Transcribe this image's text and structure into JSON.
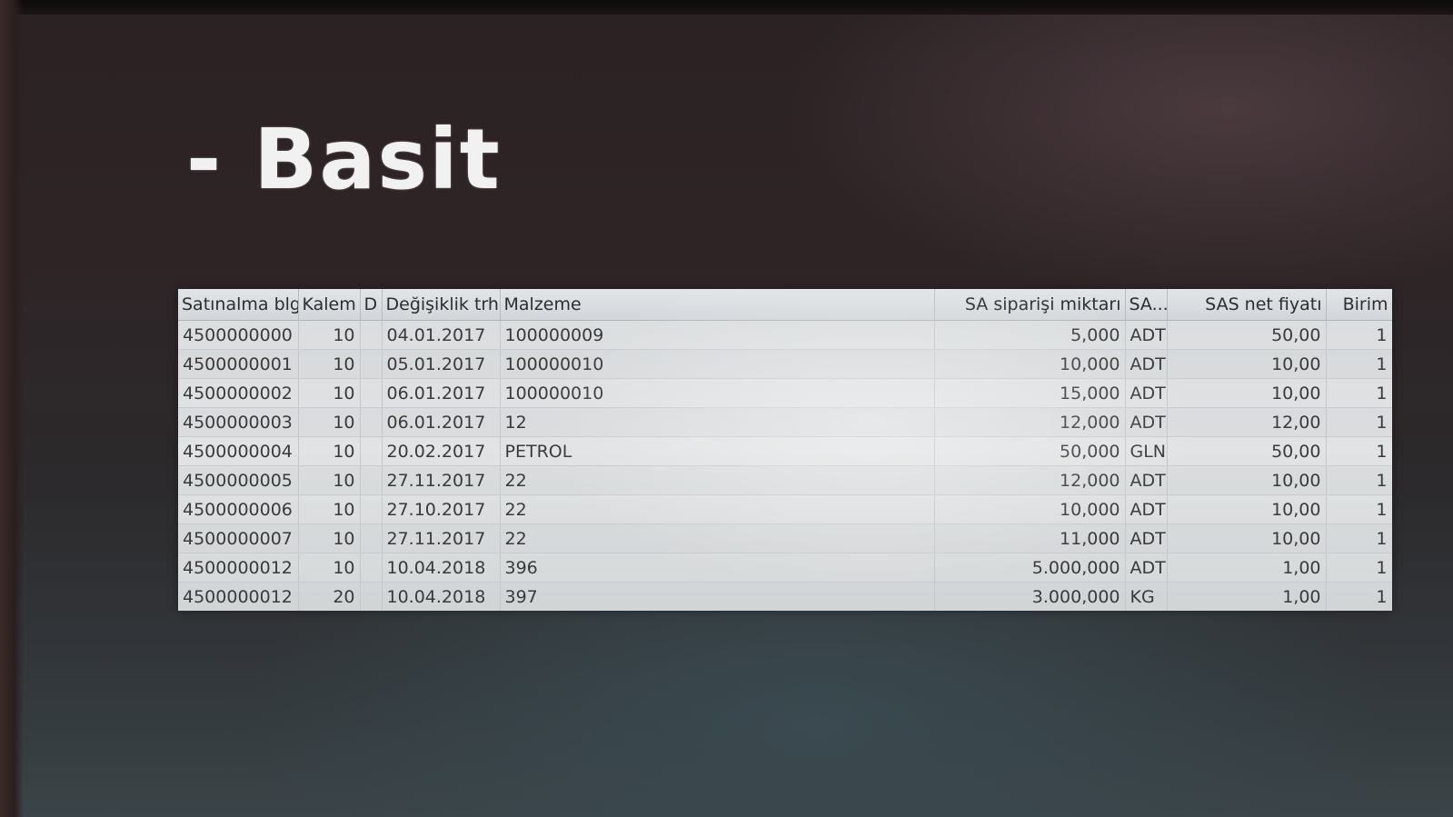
{
  "slide": {
    "title": "- Basit"
  },
  "table": {
    "columns": [
      "Satınalma blg",
      "Kalem",
      "D",
      "Değişiklik trh.",
      "Malzeme",
      "SA siparişi miktarı",
      "SA...",
      "SAS net fiyatı",
      "Birim"
    ],
    "rows": [
      {
        "doc": "4500000000",
        "item": "10",
        "d": "",
        "date": "04.01.2017",
        "material": "100000009",
        "qty": "5,000",
        "unit": "ADT",
        "price": "50,00",
        "per": "1"
      },
      {
        "doc": "4500000001",
        "item": "10",
        "d": "",
        "date": "05.01.2017",
        "material": "100000010",
        "qty": "10,000",
        "unit": "ADT",
        "price": "10,00",
        "per": "1"
      },
      {
        "doc": "4500000002",
        "item": "10",
        "d": "",
        "date": "06.01.2017",
        "material": "100000010",
        "qty": "15,000",
        "unit": "ADT",
        "price": "10,00",
        "per": "1"
      },
      {
        "doc": "4500000003",
        "item": "10",
        "d": "",
        "date": "06.01.2017",
        "material": "12",
        "qty": "12,000",
        "unit": "ADT",
        "price": "12,00",
        "per": "1"
      },
      {
        "doc": "4500000004",
        "item": "10",
        "d": "",
        "date": "20.02.2017",
        "material": "PETROL",
        "qty": "50,000",
        "unit": "GLN",
        "price": "50,00",
        "per": "1"
      },
      {
        "doc": "4500000005",
        "item": "10",
        "d": "",
        "date": "27.11.2017",
        "material": "22",
        "qty": "12,000",
        "unit": "ADT",
        "price": "10,00",
        "per": "1"
      },
      {
        "doc": "4500000006",
        "item": "10",
        "d": "",
        "date": "27.10.2017",
        "material": "22",
        "qty": "10,000",
        "unit": "ADT",
        "price": "10,00",
        "per": "1"
      },
      {
        "doc": "4500000007",
        "item": "10",
        "d": "",
        "date": "27.11.2017",
        "material": "22",
        "qty": "11,000",
        "unit": "ADT",
        "price": "10,00",
        "per": "1"
      },
      {
        "doc": "4500000012",
        "item": "10",
        "d": "",
        "date": "10.04.2018",
        "material": "396",
        "qty": "5.000,000",
        "unit": "ADT",
        "price": "1,00",
        "per": "1"
      },
      {
        "doc": "4500000012",
        "item": "20",
        "d": "",
        "date": "10.04.2018",
        "material": "397",
        "qty": "3.000,000",
        "unit": "KG",
        "price": "1,00",
        "per": "1"
      }
    ]
  }
}
